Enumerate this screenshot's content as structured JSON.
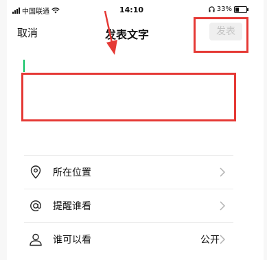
{
  "status_bar": {
    "carrier": "中国联通",
    "time": "14:10",
    "battery": "33%"
  },
  "nav": {
    "cancel_label": "取消",
    "title": "发表文字",
    "post_label": "发表"
  },
  "options": [
    {
      "icon": "location-pin-icon",
      "label": "所在位置",
      "value": ""
    },
    {
      "icon": "at-sign-icon",
      "label": "提醒谁看",
      "value": ""
    },
    {
      "icon": "person-icon",
      "label": "谁可以看",
      "value": "公开"
    }
  ],
  "colors": {
    "accent": "#07c160",
    "annotation": "#e53935",
    "disabled_text": "#c3c3c3",
    "disabled_bg": "#efefef"
  }
}
